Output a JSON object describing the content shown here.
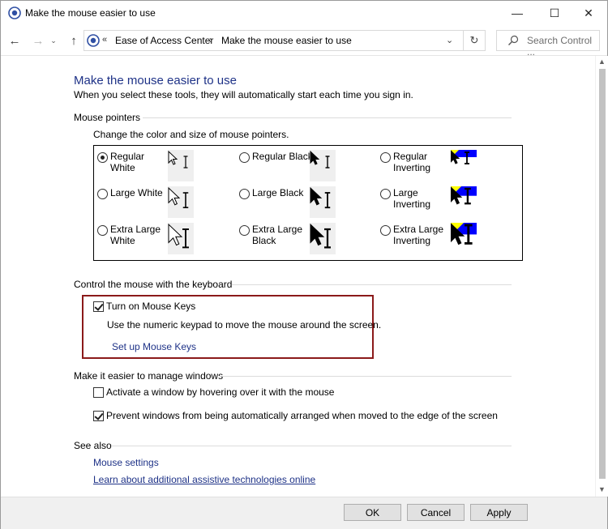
{
  "window": {
    "title": "Make the mouse easier to use",
    "controls": {
      "minimize": "—",
      "maximize": "☐",
      "close": "✕"
    }
  },
  "nav": {
    "back_glyph": "←",
    "forward_glyph": "→",
    "recent_glyph": "⌄",
    "up_glyph": "↑",
    "breadcrumb_prefix": "«",
    "breadcrumb": [
      "Ease of Access Center",
      "Make the mouse easier to use"
    ],
    "breadcrumb_sep": "›",
    "dropdown_glyph": "⌄",
    "refresh_glyph": "↻",
    "search_placeholder": "Search Control ..."
  },
  "page": {
    "title": "Make the mouse easier to use",
    "description": "When you select these tools, they will automatically start each time you sign in."
  },
  "mouse_pointers": {
    "heading": "Mouse pointers",
    "subheading": "Change the color and size of mouse pointers.",
    "options": [
      {
        "line1": "Regular",
        "line2": "White",
        "selected": true,
        "scheme": "white",
        "size": "regular"
      },
      {
        "line1": "Regular Black",
        "line2": "",
        "selected": false,
        "scheme": "black",
        "size": "regular"
      },
      {
        "line1": "Regular",
        "line2": "Inverting",
        "selected": false,
        "scheme": "invert",
        "size": "regular"
      },
      {
        "line1": "Large White",
        "line2": "",
        "selected": false,
        "scheme": "white",
        "size": "large"
      },
      {
        "line1": "Large Black",
        "line2": "",
        "selected": false,
        "scheme": "black",
        "size": "large"
      },
      {
        "line1": "Large",
        "line2": "Inverting",
        "selected": false,
        "scheme": "invert",
        "size": "large"
      },
      {
        "line1": "Extra Large",
        "line2": "White",
        "selected": false,
        "scheme": "white",
        "size": "xlarge"
      },
      {
        "line1": "Extra Large",
        "line2": "Black",
        "selected": false,
        "scheme": "black",
        "size": "xlarge"
      },
      {
        "line1": "Extra Large",
        "line2": "Inverting",
        "selected": false,
        "scheme": "invert",
        "size": "xlarge"
      }
    ]
  },
  "keyboard": {
    "heading": "Control the mouse with the keyboard",
    "mouse_keys_label": "Turn on Mouse Keys",
    "mouse_keys_checked": true,
    "mouse_keys_desc": "Use the numeric keypad to move the mouse around the screen.",
    "setup_link": "Set up Mouse Keys"
  },
  "windows": {
    "heading": "Make it easier to manage windows",
    "hover_label": "Activate a window by hovering over it with the mouse",
    "hover_checked": false,
    "snap_label": "Prevent windows from being automatically arranged when moved to the edge of the screen",
    "snap_checked": true
  },
  "see_also": {
    "heading": "See also",
    "mouse_settings": "Mouse settings",
    "learn_more": "Learn about additional assistive technologies online"
  },
  "footer": {
    "ok": "OK",
    "cancel": "Cancel",
    "apply": "Apply"
  },
  "colors": {
    "link": "#1e3287",
    "highlight_border": "#8b1a1a",
    "invert_blue": "#0000ff",
    "invert_yellow": "#ffff00"
  }
}
